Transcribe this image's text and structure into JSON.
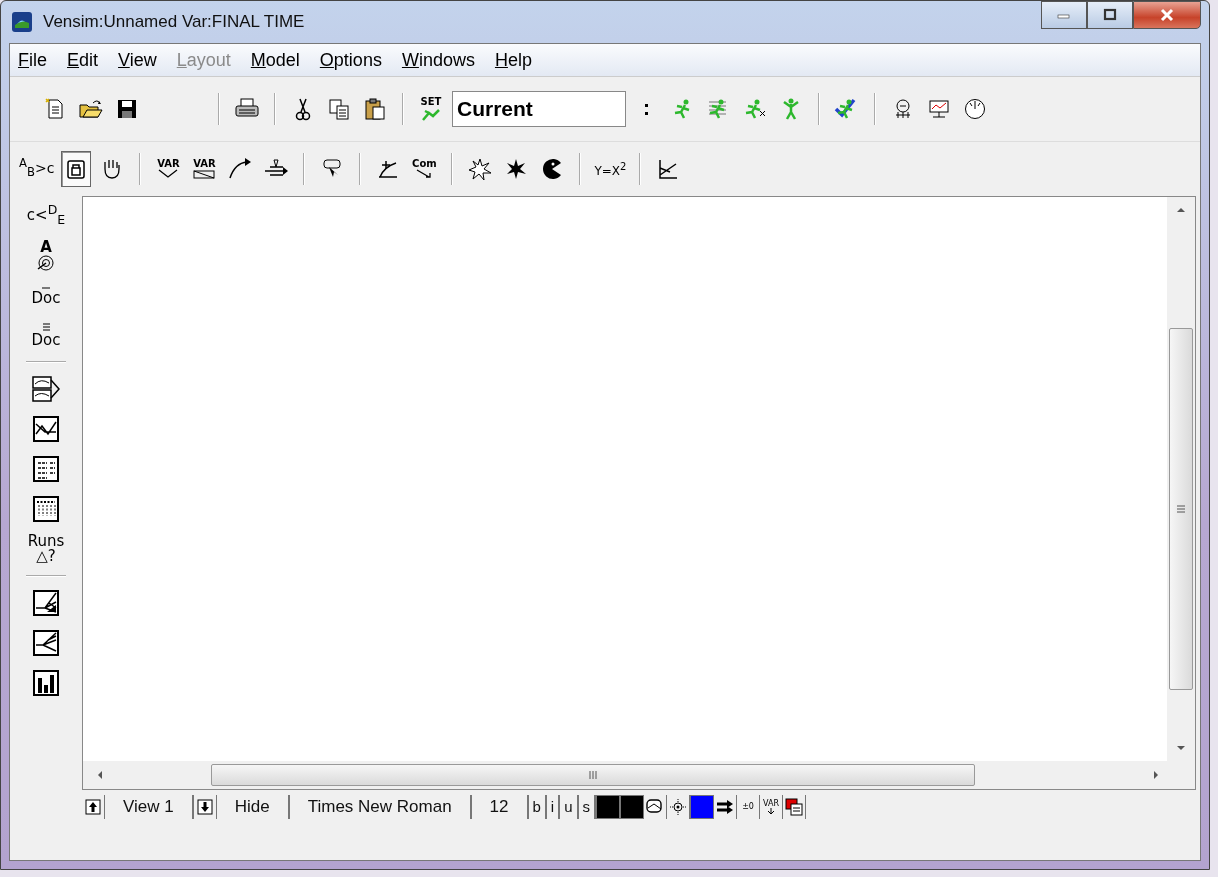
{
  "window": {
    "title": "Vensim:Unnamed Var:FINAL TIME"
  },
  "menu": [
    {
      "label": "File",
      "disabled": false
    },
    {
      "label": "Edit",
      "disabled": false
    },
    {
      "label": "View",
      "disabled": false
    },
    {
      "label": "Layout",
      "disabled": true
    },
    {
      "label": "Model",
      "disabled": false
    },
    {
      "label": "Options",
      "disabled": false
    },
    {
      "label": "Windows",
      "disabled": false
    },
    {
      "label": "Help",
      "disabled": false
    }
  ],
  "main_toolbar": [
    {
      "kind": "button"
    },
    {
      "kind": "button"
    },
    {
      "kind": "button"
    },
    {
      "kind": "separator"
    },
    {
      "kind": "button"
    },
    {
      "kind": "separator"
    },
    {
      "kind": "button"
    },
    {
      "kind": "button"
    },
    {
      "kind": "button"
    },
    {
      "kind": "separator"
    },
    {
      "kind": "button",
      "text": "SET"
    },
    {
      "kind": "field",
      "value": "Current"
    },
    {
      "kind": "button"
    },
    {
      "kind": "button"
    },
    {
      "kind": "button"
    },
    {
      "kind": "button"
    },
    {
      "kind": "button"
    },
    {
      "kind": "separator"
    },
    {
      "kind": "button"
    },
    {
      "kind": "separator"
    },
    {
      "kind": "button"
    },
    {
      "kind": "button"
    },
    {
      "kind": "button"
    }
  ],
  "sketch_toolbar": [
    {
      "kind": "button",
      "text": "$^{A}$$_{B}$>c",
      "selected": false
    },
    {
      "kind": "button",
      "selected": true
    },
    {
      "kind": "button",
      "selected": false
    },
    {
      "kind": "separator"
    },
    {
      "kind": "button",
      "text": "VAR",
      "selected": false
    },
    {
      "kind": "button",
      "text": "VAR",
      "selected": false
    },
    {
      "kind": "button",
      "selected": false
    },
    {
      "kind": "button",
      "selected": false
    },
    {
      "kind": "separator"
    },
    {
      "kind": "button",
      "selected": false
    },
    {
      "kind": "separator"
    },
    {
      "kind": "button",
      "selected": false
    },
    {
      "kind": "button",
      "text": "Com",
      "selected": false
    },
    {
      "kind": "separator"
    },
    {
      "kind": "button",
      "selected": false
    },
    {
      "kind": "button",
      "selected": false
    },
    {
      "kind": "button",
      "selected": false
    },
    {
      "kind": "separator"
    },
    {
      "kind": "button",
      "text": "Y=X$^{2}$",
      "selected": false
    },
    {
      "kind": "separator"
    },
    {
      "kind": "button",
      "selected": false
    }
  ],
  "analysis_toolbar": [
    {
      "kind": "button",
      "text": "c<$^{D}$$_{E}$"
    },
    {
      "kind": "button",
      "text": "A"
    },
    {
      "kind": "button",
      "text": "Doc"
    },
    {
      "kind": "button",
      "text": "Doc"
    },
    {
      "kind": "separator"
    },
    {
      "kind": "button"
    },
    {
      "kind": "button"
    },
    {
      "kind": "button"
    },
    {
      "kind": "button"
    },
    {
      "kind": "button",
      "text": "Runs △?"
    },
    {
      "kind": "separator"
    },
    {
      "kind": "button"
    },
    {
      "kind": "button"
    },
    {
      "kind": "button"
    }
  ],
  "status_bar": [
    {
      "kind": "button"
    },
    {
      "kind": "text",
      "text": "View 1"
    },
    {
      "kind": "button"
    },
    {
      "kind": "text",
      "text": "Hide"
    },
    {
      "kind": "text",
      "text": "Times New Roman"
    },
    {
      "kind": "text",
      "text": "12"
    },
    {
      "kind": "toggle",
      "text": "b"
    },
    {
      "kind": "toggle",
      "text": "i"
    },
    {
      "kind": "toggle",
      "text": "u"
    },
    {
      "kind": "toggle",
      "text": "s"
    },
    {
      "kind": "swatch",
      "color": "#000000"
    },
    {
      "kind": "swatch",
      "color": "#000000"
    },
    {
      "kind": "button"
    },
    {
      "kind": "button"
    },
    {
      "kind": "swatch",
      "color": "#0000ff"
    },
    {
      "kind": "button"
    },
    {
      "kind": "button",
      "text": "±0"
    },
    {
      "kind": "button",
      "text": "VAR"
    },
    {
      "kind": "button"
    }
  ]
}
